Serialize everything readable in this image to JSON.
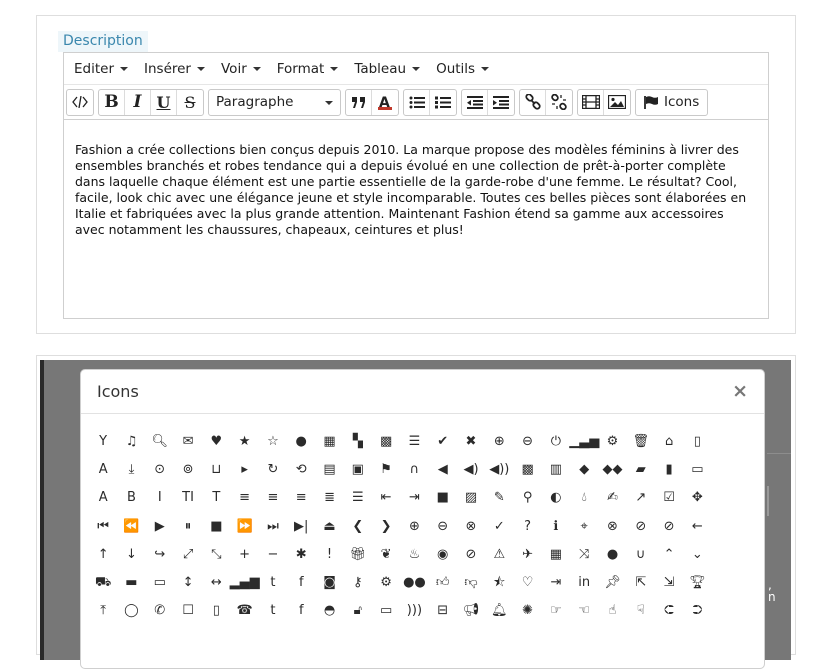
{
  "field": {
    "label": "Description"
  },
  "menubar": [
    {
      "label": "Editer"
    },
    {
      "label": "Insérer"
    },
    {
      "label": "Voir"
    },
    {
      "label": "Format"
    },
    {
      "label": "Tableau"
    },
    {
      "label": "Outils"
    }
  ],
  "toolbar": {
    "code_icon": "code-icon",
    "bold": "B",
    "italic": "I",
    "underline": "U",
    "strike": "S",
    "block_select": "Paragraphe",
    "icons_label": "Icons"
  },
  "content": {
    "text": "Fashion a crée collections bien conçus depuis 2010. La marque propose des modèles féminins à livrer des ensembles branchés et robes tendance qui a depuis évolué en une collection de prêt-à-porter complète dans laquelle chaque élément est une partie essentielle de la garde-robe d'une femme. Le résultat? Cool, facile, look chic avec une élégance jeune et style incomparable. Toutes ces belles pièces sont élaborées en Italie et fabriquées avec la plus grande attention. Maintenant Fashion étend sa gamme aux accessoires avec notamment les chaussures, chapeaux, ceintures et plus!"
  },
  "modal": {
    "title": "Icons",
    "close": "×",
    "icons": [
      {
        "name": "glass-icon",
        "glyph": "Y"
      },
      {
        "name": "music-icon",
        "glyph": "♫"
      },
      {
        "name": "search-icon",
        "glyph": "🔍︎"
      },
      {
        "name": "envelope-icon",
        "glyph": "✉"
      },
      {
        "name": "heart-icon",
        "glyph": "♥"
      },
      {
        "name": "star-icon",
        "glyph": "★"
      },
      {
        "name": "star-empty-icon",
        "glyph": "☆"
      },
      {
        "name": "user-icon",
        "glyph": "●"
      },
      {
        "name": "film-icon",
        "glyph": "▦"
      },
      {
        "name": "th-large-icon",
        "glyph": "▚"
      },
      {
        "name": "th-icon",
        "glyph": "▩"
      },
      {
        "name": "th-list-icon",
        "glyph": "☰"
      },
      {
        "name": "ok-icon",
        "glyph": "✔"
      },
      {
        "name": "remove-icon",
        "glyph": "✖"
      },
      {
        "name": "zoom-in-icon",
        "glyph": "⊕"
      },
      {
        "name": "zoom-out-icon",
        "glyph": "⊖"
      },
      {
        "name": "off-icon",
        "glyph": "⏻"
      },
      {
        "name": "signal-icon",
        "glyph": "▁▃▅"
      },
      {
        "name": "cog-icon",
        "glyph": "⚙"
      },
      {
        "name": "trash-icon",
        "glyph": "🗑︎"
      },
      {
        "name": "home-icon",
        "glyph": "⌂"
      },
      {
        "name": "file-icon",
        "glyph": "▯"
      },
      {
        "name": "road-icon",
        "glyph": "A"
      },
      {
        "name": "download-alt-icon",
        "glyph": "⤓"
      },
      {
        "name": "download-icon",
        "glyph": "⊙"
      },
      {
        "name": "upload-icon",
        "glyph": "⊚"
      },
      {
        "name": "inbox-icon",
        "glyph": "⊔"
      },
      {
        "name": "play-circle-icon",
        "glyph": "▸"
      },
      {
        "name": "repeat-icon",
        "glyph": "↻"
      },
      {
        "name": "refresh-icon",
        "glyph": "⟲"
      },
      {
        "name": "list-alt-icon",
        "glyph": "▤"
      },
      {
        "name": "lock-icon",
        "glyph": "▣"
      },
      {
        "name": "flag-icon",
        "glyph": "⚑"
      },
      {
        "name": "headphones-icon",
        "glyph": "∩"
      },
      {
        "name": "volume-off-icon",
        "glyph": "◀"
      },
      {
        "name": "volume-down-icon",
        "glyph": "◀)"
      },
      {
        "name": "volume-up-icon",
        "glyph": "◀))"
      },
      {
        "name": "qrcode-icon",
        "glyph": "▩"
      },
      {
        "name": "barcode-icon",
        "glyph": "▥"
      },
      {
        "name": "tag-icon",
        "glyph": "◆"
      },
      {
        "name": "tags-icon",
        "glyph": "◆◆"
      },
      {
        "name": "book-icon",
        "glyph": "▰"
      },
      {
        "name": "bookmark-icon",
        "glyph": "▮"
      },
      {
        "name": "print-icon",
        "glyph": "▭"
      },
      {
        "name": "font-icon",
        "glyph": "A"
      },
      {
        "name": "bold-icon",
        "glyph": "B"
      },
      {
        "name": "italic-icon",
        "glyph": "I"
      },
      {
        "name": "text-height-icon",
        "glyph": "TI"
      },
      {
        "name": "text-width-icon",
        "glyph": "T"
      },
      {
        "name": "align-left-icon",
        "glyph": "≡"
      },
      {
        "name": "align-center-icon",
        "glyph": "≡"
      },
      {
        "name": "align-right-icon",
        "glyph": "≡"
      },
      {
        "name": "align-justify-icon",
        "glyph": "≣"
      },
      {
        "name": "list-icon",
        "glyph": "☰"
      },
      {
        "name": "indent-left-icon",
        "glyph": "⇤"
      },
      {
        "name": "indent-right-icon",
        "glyph": "⇥"
      },
      {
        "name": "facetime-video-icon",
        "glyph": "■"
      },
      {
        "name": "picture-icon",
        "glyph": "▨"
      },
      {
        "name": "pencil-icon",
        "glyph": "✎"
      },
      {
        "name": "map-marker-icon",
        "glyph": "⚲"
      },
      {
        "name": "adjust-icon",
        "glyph": "◐"
      },
      {
        "name": "tint-icon",
        "glyph": "💧︎"
      },
      {
        "name": "edit-icon",
        "glyph": "✍"
      },
      {
        "name": "share-icon",
        "glyph": "↗"
      },
      {
        "name": "check-icon",
        "glyph": "☑"
      },
      {
        "name": "move-icon",
        "glyph": "✥"
      },
      {
        "name": "fast-backward-icon",
        "glyph": "⏮"
      },
      {
        "name": "backward-icon",
        "glyph": "⏪"
      },
      {
        "name": "play-icon",
        "glyph": "▶"
      },
      {
        "name": "pause-icon",
        "glyph": "⏸"
      },
      {
        "name": "stop-icon",
        "glyph": "■"
      },
      {
        "name": "forward-icon",
        "glyph": "⏩"
      },
      {
        "name": "fast-forward-icon",
        "glyph": "⏭"
      },
      {
        "name": "step-forward-icon",
        "glyph": "▶|"
      },
      {
        "name": "eject-icon",
        "glyph": "⏏"
      },
      {
        "name": "chevron-left-icon",
        "glyph": "❮"
      },
      {
        "name": "chevron-right-icon",
        "glyph": "❯"
      },
      {
        "name": "plus-sign-icon",
        "glyph": "⊕"
      },
      {
        "name": "minus-sign-icon",
        "glyph": "⊖"
      },
      {
        "name": "remove-sign-icon",
        "glyph": "⊗"
      },
      {
        "name": "ok-sign-icon",
        "glyph": "✓"
      },
      {
        "name": "question-sign-icon",
        "glyph": "?"
      },
      {
        "name": "info-sign-icon",
        "glyph": "ℹ"
      },
      {
        "name": "screenshot-icon",
        "glyph": "⌖"
      },
      {
        "name": "remove-circle-icon",
        "glyph": "⊗"
      },
      {
        "name": "ok-circle-icon",
        "glyph": "⊘"
      },
      {
        "name": "ban-circle-icon",
        "glyph": "⊘"
      },
      {
        "name": "arrow-left-icon",
        "glyph": "←"
      },
      {
        "name": "arrow-up-icon",
        "glyph": "↑"
      },
      {
        "name": "arrow-down-icon",
        "glyph": "↓"
      },
      {
        "name": "share-alt-icon",
        "glyph": "↪"
      },
      {
        "name": "resize-full-icon",
        "glyph": "⤢"
      },
      {
        "name": "resize-small-icon",
        "glyph": "⤡"
      },
      {
        "name": "plus-icon",
        "glyph": "+"
      },
      {
        "name": "minus-icon",
        "glyph": "−"
      },
      {
        "name": "asterisk-icon",
        "glyph": "✱"
      },
      {
        "name": "exclamation-sign-icon",
        "glyph": "!"
      },
      {
        "name": "gift-icon",
        "glyph": "🎁︎"
      },
      {
        "name": "leaf-icon",
        "glyph": "❦"
      },
      {
        "name": "fire-icon",
        "glyph": "♨"
      },
      {
        "name": "eye-open-icon",
        "glyph": "◉"
      },
      {
        "name": "eye-close-icon",
        "glyph": "⊘"
      },
      {
        "name": "warning-sign-icon",
        "glyph": "⚠"
      },
      {
        "name": "plane-icon",
        "glyph": "✈"
      },
      {
        "name": "calendar-icon",
        "glyph": "▦"
      },
      {
        "name": "random-icon",
        "glyph": "⤨"
      },
      {
        "name": "comment-icon",
        "glyph": "●"
      },
      {
        "name": "magnet-icon",
        "glyph": "∪"
      },
      {
        "name": "chevron-up-icon",
        "glyph": "⌃"
      },
      {
        "name": "chevron-down-icon",
        "glyph": "⌄"
      },
      {
        "name": "shopping-cart-icon",
        "glyph": "⛟"
      },
      {
        "name": "folder-close-icon",
        "glyph": "▬"
      },
      {
        "name": "folder-open-icon",
        "glyph": "▭"
      },
      {
        "name": "resize-vertical-icon",
        "glyph": "↕"
      },
      {
        "name": "resize-horizontal-icon",
        "glyph": "↔"
      },
      {
        "name": "bar-chart-icon",
        "glyph": "▂▄▆"
      },
      {
        "name": "twitter-sign-icon",
        "glyph": "t"
      },
      {
        "name": "facebook-sign-icon",
        "glyph": "f"
      },
      {
        "name": "camera-retro-icon",
        "glyph": "◙"
      },
      {
        "name": "key-icon",
        "glyph": "⚷"
      },
      {
        "name": "cogs-icon",
        "glyph": "⚙"
      },
      {
        "name": "comments-icon",
        "glyph": "●●"
      },
      {
        "name": "thumbs-up-icon",
        "glyph": "👍︎"
      },
      {
        "name": "thumbs-down-icon",
        "glyph": "👎︎"
      },
      {
        "name": "star-half-icon",
        "glyph": "⯪"
      },
      {
        "name": "heart-empty-icon",
        "glyph": "♡"
      },
      {
        "name": "signout-icon",
        "glyph": "⇥"
      },
      {
        "name": "linkedin-sign-icon",
        "glyph": "in"
      },
      {
        "name": "pushpin-icon",
        "glyph": "📌︎"
      },
      {
        "name": "external-link-icon",
        "glyph": "⇱"
      },
      {
        "name": "signin-icon",
        "glyph": "⇲"
      },
      {
        "name": "trophy-icon",
        "glyph": "🏆︎"
      },
      {
        "name": "upload-alt-icon",
        "glyph": "⤒"
      },
      {
        "name": "lemon-icon",
        "glyph": "◯"
      },
      {
        "name": "phone-icon",
        "glyph": "✆"
      },
      {
        "name": "check-empty-icon",
        "glyph": "☐"
      },
      {
        "name": "bookmark-empty-icon",
        "glyph": "▯"
      },
      {
        "name": "phone-sign-icon",
        "glyph": "☎"
      },
      {
        "name": "twitter-icon",
        "glyph": "t"
      },
      {
        "name": "facebook-icon",
        "glyph": "f"
      },
      {
        "name": "github-icon",
        "glyph": "◓"
      },
      {
        "name": "unlock-icon",
        "glyph": "🔓︎"
      },
      {
        "name": "credit-card-icon",
        "glyph": "▭"
      },
      {
        "name": "rss-icon",
        "glyph": ")))"
      },
      {
        "name": "hdd-icon",
        "glyph": "⊟"
      },
      {
        "name": "bullhorn-icon",
        "glyph": "📢︎"
      },
      {
        "name": "bell-icon",
        "glyph": "🔔︎"
      },
      {
        "name": "certificate-icon",
        "glyph": "✺"
      },
      {
        "name": "hand-right-icon",
        "glyph": "☞"
      },
      {
        "name": "hand-left-icon",
        "glyph": "☜"
      },
      {
        "name": "hand-up-icon",
        "glyph": "☝"
      },
      {
        "name": "hand-down-icon",
        "glyph": "☟"
      },
      {
        "name": "circle-arrow-left-icon",
        "glyph": "⮈"
      },
      {
        "name": "circle-arrow-right-icon",
        "glyph": "⮊"
      }
    ]
  },
  "behind": {
    "frag1": ",",
    "frag2": "n"
  },
  "colors": {
    "label_bg": "#eef6fa",
    "label_text": "#3a87ad",
    "backdrop": "#777777"
  }
}
